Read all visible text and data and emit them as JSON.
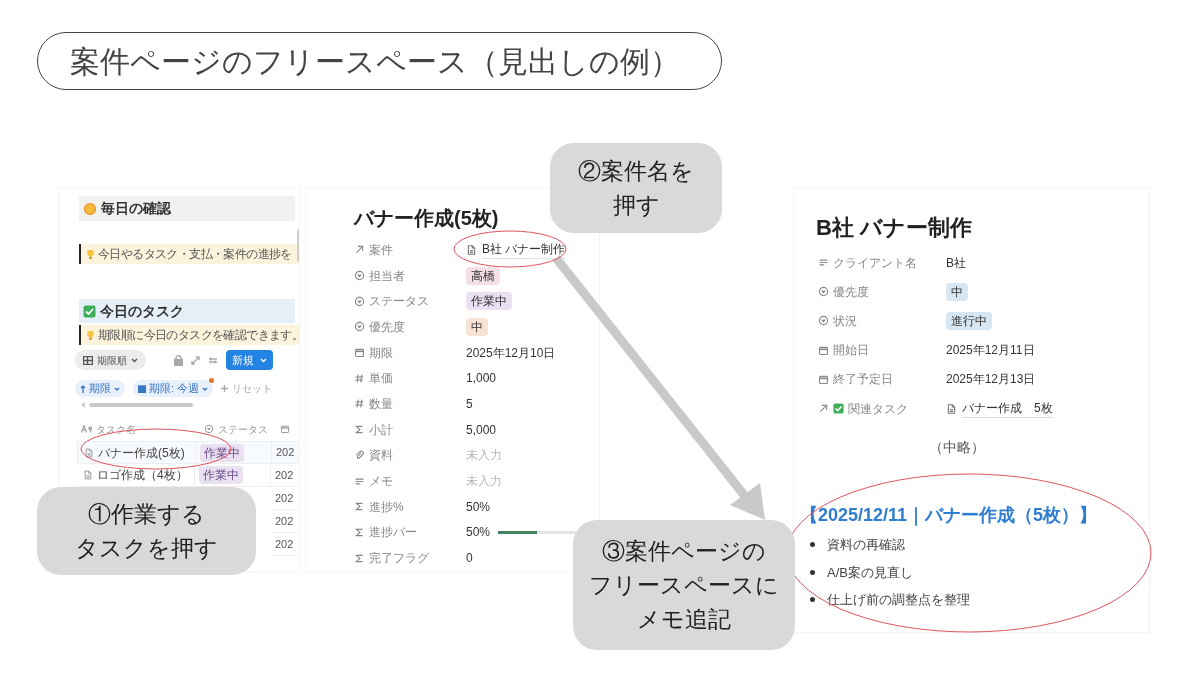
{
  "slide_title": "案件ページのフリースペース（見出しの例）",
  "dashboard": {
    "heading_1": "毎日の確認",
    "callout_1": "今日やるタスク・支払・案件の進捗を",
    "heading_2": "今日のタスク",
    "callout_2": "期限順に今日のタスクを確認できます。",
    "view_tab": "期限順",
    "new_button": "新規",
    "filters": [
      {
        "kind": "sort",
        "label": "期限"
      },
      {
        "kind": "date",
        "label": "期限: 今週",
        "modified": true
      },
      {
        "kind": "reset",
        "label": "リセット"
      }
    ],
    "columns": [
      "タスク名",
      "ステータス"
    ],
    "rows": [
      {
        "name": "バナー作成(5枚)",
        "status": "作業中",
        "date": "202",
        "selected": true
      },
      {
        "name": "ロゴ作成（4枚）",
        "status": "作業中",
        "date": "202",
        "selected": false
      },
      {
        "date": "202",
        "selected": false
      },
      {
        "date": "202",
        "selected": false
      },
      {
        "date": "202",
        "selected": false
      }
    ]
  },
  "task_page": {
    "title": "バナー作成(5枚)",
    "properties": [
      {
        "kind": "relation",
        "label": "案件",
        "value": "B社 バナー制作",
        "empty": false
      },
      {
        "kind": "select",
        "label": "担当者",
        "value": "高橋",
        "color": "#f4dfe8",
        "empty": false
      },
      {
        "kind": "select",
        "label": "ステータス",
        "value": "作業中",
        "color": "#e9e0f1",
        "empty": false
      },
      {
        "kind": "select",
        "label": "優先度",
        "value": "中",
        "color": "#f7e2d3",
        "empty": false
      },
      {
        "kind": "date",
        "label": "期限",
        "value": "2025年12月10日",
        "empty": false
      },
      {
        "kind": "number",
        "label": "単価",
        "value": "1,000",
        "empty": false
      },
      {
        "kind": "number",
        "label": "数量",
        "value": "5",
        "empty": false
      },
      {
        "kind": "formula",
        "label": "小計",
        "value": "5,000",
        "empty": false
      },
      {
        "kind": "file",
        "label": "資料",
        "value": "未入力",
        "empty": true
      },
      {
        "kind": "text",
        "label": "メモ",
        "value": "未入力",
        "empty": true
      },
      {
        "kind": "formula",
        "label": "進捗%",
        "value": "50%",
        "empty": false
      },
      {
        "kind": "progress",
        "label": "進捗バー",
        "value": "50%",
        "level": 0.5,
        "empty": false
      },
      {
        "kind": "formula",
        "label": "完了フラグ",
        "value": "0",
        "empty": false
      }
    ]
  },
  "project_page": {
    "title": "B社 バナー制作",
    "properties": [
      {
        "kind": "text",
        "label": "クライアント名",
        "value": "B社"
      },
      {
        "kind": "select",
        "label": "優先度",
        "value": "中",
        "color": "#d6e6f3"
      },
      {
        "kind": "select",
        "label": "状況",
        "value": "進行中",
        "color": "#d6e6f3"
      },
      {
        "kind": "date",
        "label": "開始日",
        "value": "2025年12月11日"
      },
      {
        "kind": "date",
        "label": "終了予定日",
        "value": "2025年12月13日"
      },
      {
        "kind": "task_relation",
        "label": "関連タスク",
        "value": "バナー作成　5枚"
      }
    ],
    "omitted": "（中略）",
    "memo_heading": "【2025/12/11｜バナー作成（5枚）】",
    "memo_items": [
      "資料の再確認",
      "A/B案の見直し",
      "仕上げ前の調整点を整理"
    ]
  },
  "callouts": [
    {
      "kind": "step1",
      "lines": [
        "①作業する",
        "タスクを押す"
      ]
    },
    {
      "kind": "step2",
      "lines": [
        "②案件名を",
        "押す"
      ]
    },
    {
      "kind": "step3",
      "lines": [
        "③案件ページの",
        "フリースペースに",
        "メモ追記"
      ]
    }
  ]
}
